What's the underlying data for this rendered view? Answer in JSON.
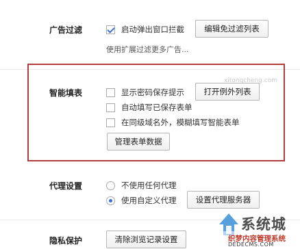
{
  "ad_filter": {
    "label": "广告过滤",
    "popup_block_label": "启动弹出窗口拦截",
    "popup_block_checked": true,
    "edit_whitelist_button": "编辑免过滤列表",
    "extension_hint": "使用扩展过滤更多广告..."
  },
  "smart_form": {
    "label": "智能填表",
    "show_password_prompt": "显示密码保存提示",
    "open_exceptions_button": "打开例外列表",
    "autofill_saved": "自动填写已保存表单",
    "fuzzy_fill_same_domain": "在同级域名外，模糊填写智能表单",
    "manage_form_data_button": "管理表单数据"
  },
  "proxy": {
    "label": "代理设置",
    "no_proxy": "不使用任何代理",
    "custom_proxy": "使用自定义代理",
    "selected": "custom_proxy",
    "set_proxy_button": "设置代理服务器"
  },
  "privacy": {
    "label": "隐私保护",
    "clear_history_button": "清除浏览记录设置"
  },
  "watermark": {
    "url": "xitongcheng.com",
    "logo_text": "系统城",
    "logo_sub": "织梦内容管理系统",
    "logo_domain": "DEDECMS.COM"
  },
  "colors": {
    "highlight_border": "#b23a3a",
    "accent_blue": "#3b6fd6"
  }
}
